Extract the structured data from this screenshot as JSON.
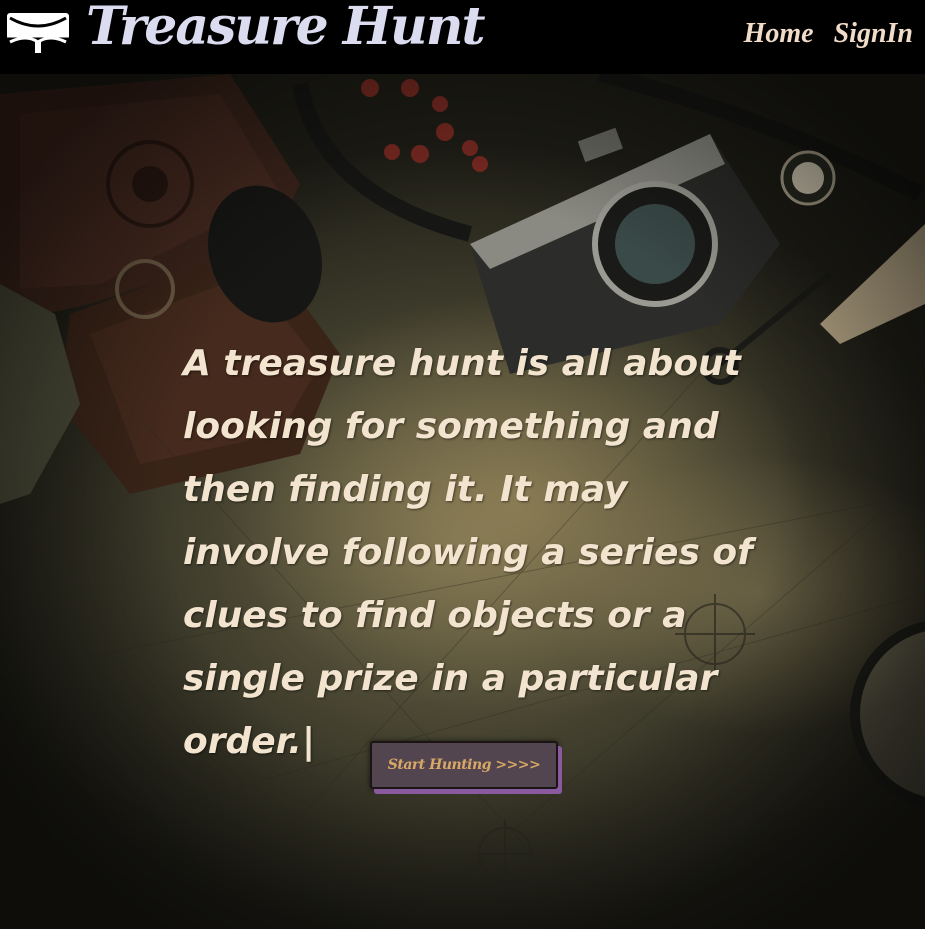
{
  "header": {
    "brand": "Treasure Hunt",
    "nav": [
      {
        "label": "Home"
      },
      {
        "label": "SignIn"
      }
    ]
  },
  "hero": {
    "text": "A treasure hunt is all about looking for something and then finding it. It may involve following a series of clues to find objects or a single prize in a particular order.|",
    "button_label": "Start Hunting >>>>"
  },
  "icons": [
    "treasure-chest-icon"
  ],
  "colors": {
    "nav_bg": "#000000",
    "brand_text": "#dcdcf0",
    "nav_text": "#f0dcc8",
    "hero_text": "#f3e4cf",
    "button_bg": "#53454f",
    "button_text": "#d8a866",
    "button_shadow": "#8a5a9e"
  }
}
